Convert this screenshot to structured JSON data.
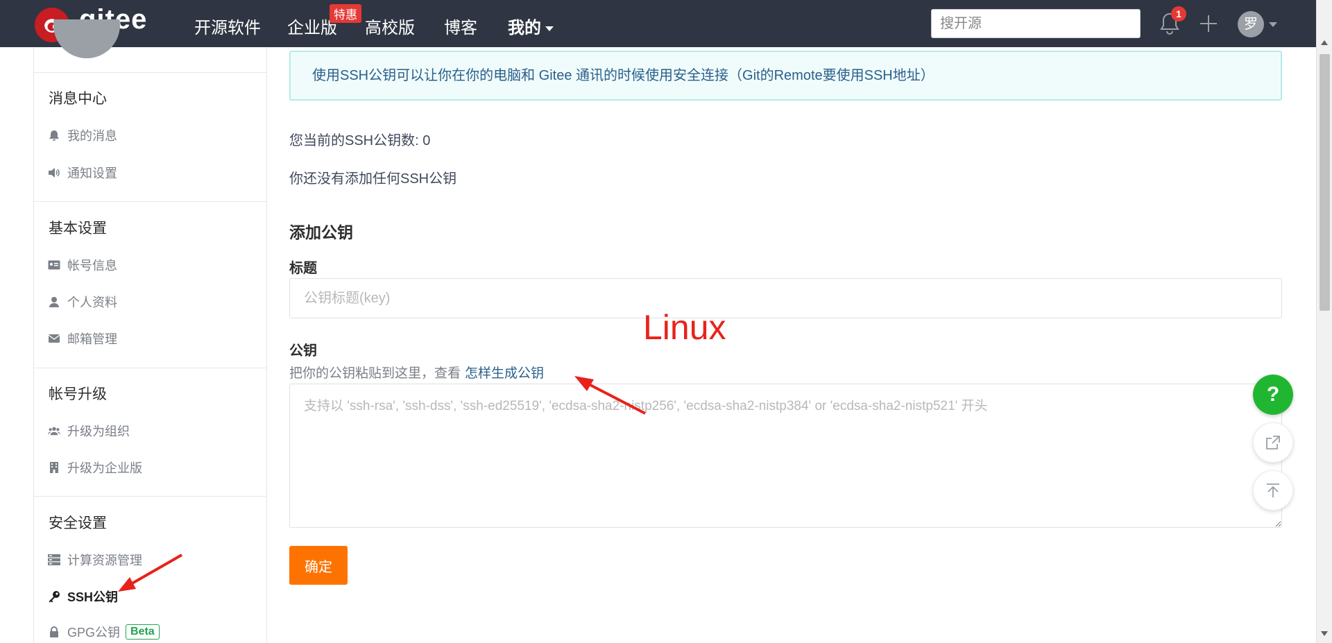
{
  "topbar": {
    "brand": "gitee",
    "nav": [
      {
        "label": "开源软件"
      },
      {
        "label": "企业版",
        "badge": "特惠"
      },
      {
        "label": "高校版"
      },
      {
        "label": "博客"
      },
      {
        "label": "我的"
      }
    ],
    "search_placeholder": "搜开源",
    "notification_count": "1",
    "avatar_text": "罗"
  },
  "sidebar": {
    "sections": [
      {
        "title": "消息中心",
        "items": [
          {
            "label": "我的消息",
            "icon": "bell-icon"
          },
          {
            "label": "通知设置",
            "icon": "speaker-icon"
          }
        ]
      },
      {
        "title": "基本设置",
        "items": [
          {
            "label": "帐号信息",
            "icon": "id-card-icon"
          },
          {
            "label": "个人资料",
            "icon": "user-icon"
          },
          {
            "label": "邮箱管理",
            "icon": "envelope-icon"
          }
        ]
      },
      {
        "title": "帐号升级",
        "items": [
          {
            "label": "升级为组织",
            "icon": "users-icon"
          },
          {
            "label": "升级为企业版",
            "icon": "building-icon"
          }
        ]
      },
      {
        "title": "安全设置",
        "items": [
          {
            "label": "计算资源管理",
            "icon": "server-icon"
          },
          {
            "label": "SSH公钥",
            "icon": "key-icon",
            "active": true
          },
          {
            "label": "GPG公钥",
            "icon": "lock-icon",
            "badge": "Beta"
          }
        ]
      }
    ]
  },
  "main": {
    "info": "使用SSH公钥可以让你在你的电脑和 Gitee 通讯的时候使用安全连接（Git的Remote要使用SSH地址）",
    "key_count": "您当前的SSH公钥数: 0",
    "no_keys": "你还没有添加任何SSH公钥",
    "add_heading": "添加公钥",
    "title_label": "标题",
    "title_placeholder": "公钥标题(key)",
    "key_label": "公钥",
    "key_hint": "把你的公钥粘贴到这里，查看",
    "key_hint_link": "怎样生成公钥",
    "key_placeholder": "支持以 'ssh-rsa', 'ssh-dss', 'ssh-ed25519', 'ecdsa-sha2-nistp256', 'ecdsa-sha2-nistp384' or 'ecdsa-sha2-nistp521' 开头",
    "submit_label": "确定"
  },
  "floating": {
    "help_label": "?"
  },
  "annotation": {
    "text": "Linux",
    "color": "#e8221b"
  },
  "colors": {
    "topbar": "#2f3542",
    "brand_red": "#c71d23",
    "submit": "#fe7300",
    "help": "#21b632",
    "link": "#2a5f8a"
  }
}
